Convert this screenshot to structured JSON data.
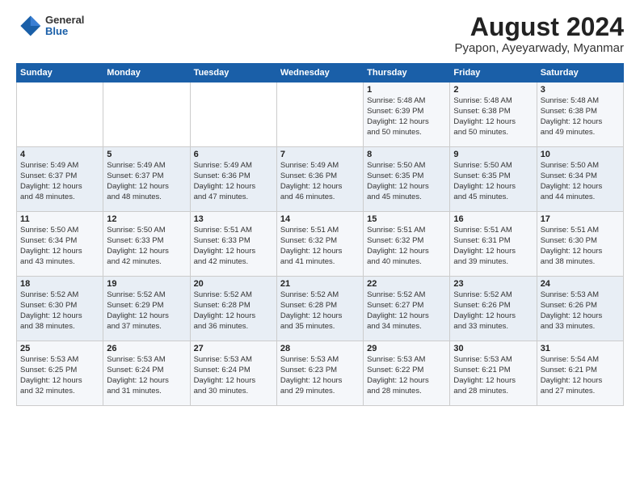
{
  "header": {
    "logo_general": "General",
    "logo_blue": "Blue",
    "title": "August 2024",
    "subtitle": "Pyapon, Ayeyarwady, Myanmar"
  },
  "calendar": {
    "weekdays": [
      "Sunday",
      "Monday",
      "Tuesday",
      "Wednesday",
      "Thursday",
      "Friday",
      "Saturday"
    ],
    "weeks": [
      [
        {
          "day": "",
          "detail": ""
        },
        {
          "day": "",
          "detail": ""
        },
        {
          "day": "",
          "detail": ""
        },
        {
          "day": "",
          "detail": ""
        },
        {
          "day": "1",
          "detail": "Sunrise: 5:48 AM\nSunset: 6:39 PM\nDaylight: 12 hours\nand 50 minutes."
        },
        {
          "day": "2",
          "detail": "Sunrise: 5:48 AM\nSunset: 6:38 PM\nDaylight: 12 hours\nand 50 minutes."
        },
        {
          "day": "3",
          "detail": "Sunrise: 5:48 AM\nSunset: 6:38 PM\nDaylight: 12 hours\nand 49 minutes."
        }
      ],
      [
        {
          "day": "4",
          "detail": "Sunrise: 5:49 AM\nSunset: 6:37 PM\nDaylight: 12 hours\nand 48 minutes."
        },
        {
          "day": "5",
          "detail": "Sunrise: 5:49 AM\nSunset: 6:37 PM\nDaylight: 12 hours\nand 48 minutes."
        },
        {
          "day": "6",
          "detail": "Sunrise: 5:49 AM\nSunset: 6:36 PM\nDaylight: 12 hours\nand 47 minutes."
        },
        {
          "day": "7",
          "detail": "Sunrise: 5:49 AM\nSunset: 6:36 PM\nDaylight: 12 hours\nand 46 minutes."
        },
        {
          "day": "8",
          "detail": "Sunrise: 5:50 AM\nSunset: 6:35 PM\nDaylight: 12 hours\nand 45 minutes."
        },
        {
          "day": "9",
          "detail": "Sunrise: 5:50 AM\nSunset: 6:35 PM\nDaylight: 12 hours\nand 45 minutes."
        },
        {
          "day": "10",
          "detail": "Sunrise: 5:50 AM\nSunset: 6:34 PM\nDaylight: 12 hours\nand 44 minutes."
        }
      ],
      [
        {
          "day": "11",
          "detail": "Sunrise: 5:50 AM\nSunset: 6:34 PM\nDaylight: 12 hours\nand 43 minutes."
        },
        {
          "day": "12",
          "detail": "Sunrise: 5:50 AM\nSunset: 6:33 PM\nDaylight: 12 hours\nand 42 minutes."
        },
        {
          "day": "13",
          "detail": "Sunrise: 5:51 AM\nSunset: 6:33 PM\nDaylight: 12 hours\nand 42 minutes."
        },
        {
          "day": "14",
          "detail": "Sunrise: 5:51 AM\nSunset: 6:32 PM\nDaylight: 12 hours\nand 41 minutes."
        },
        {
          "day": "15",
          "detail": "Sunrise: 5:51 AM\nSunset: 6:32 PM\nDaylight: 12 hours\nand 40 minutes."
        },
        {
          "day": "16",
          "detail": "Sunrise: 5:51 AM\nSunset: 6:31 PM\nDaylight: 12 hours\nand 39 minutes."
        },
        {
          "day": "17",
          "detail": "Sunrise: 5:51 AM\nSunset: 6:30 PM\nDaylight: 12 hours\nand 38 minutes."
        }
      ],
      [
        {
          "day": "18",
          "detail": "Sunrise: 5:52 AM\nSunset: 6:30 PM\nDaylight: 12 hours\nand 38 minutes."
        },
        {
          "day": "19",
          "detail": "Sunrise: 5:52 AM\nSunset: 6:29 PM\nDaylight: 12 hours\nand 37 minutes."
        },
        {
          "day": "20",
          "detail": "Sunrise: 5:52 AM\nSunset: 6:28 PM\nDaylight: 12 hours\nand 36 minutes."
        },
        {
          "day": "21",
          "detail": "Sunrise: 5:52 AM\nSunset: 6:28 PM\nDaylight: 12 hours\nand 35 minutes."
        },
        {
          "day": "22",
          "detail": "Sunrise: 5:52 AM\nSunset: 6:27 PM\nDaylight: 12 hours\nand 34 minutes."
        },
        {
          "day": "23",
          "detail": "Sunrise: 5:52 AM\nSunset: 6:26 PM\nDaylight: 12 hours\nand 33 minutes."
        },
        {
          "day": "24",
          "detail": "Sunrise: 5:53 AM\nSunset: 6:26 PM\nDaylight: 12 hours\nand 33 minutes."
        }
      ],
      [
        {
          "day": "25",
          "detail": "Sunrise: 5:53 AM\nSunset: 6:25 PM\nDaylight: 12 hours\nand 32 minutes."
        },
        {
          "day": "26",
          "detail": "Sunrise: 5:53 AM\nSunset: 6:24 PM\nDaylight: 12 hours\nand 31 minutes."
        },
        {
          "day": "27",
          "detail": "Sunrise: 5:53 AM\nSunset: 6:24 PM\nDaylight: 12 hours\nand 30 minutes."
        },
        {
          "day": "28",
          "detail": "Sunrise: 5:53 AM\nSunset: 6:23 PM\nDaylight: 12 hours\nand 29 minutes."
        },
        {
          "day": "29",
          "detail": "Sunrise: 5:53 AM\nSunset: 6:22 PM\nDaylight: 12 hours\nand 28 minutes."
        },
        {
          "day": "30",
          "detail": "Sunrise: 5:53 AM\nSunset: 6:21 PM\nDaylight: 12 hours\nand 28 minutes."
        },
        {
          "day": "31",
          "detail": "Sunrise: 5:54 AM\nSunset: 6:21 PM\nDaylight: 12 hours\nand 27 minutes."
        }
      ]
    ]
  }
}
